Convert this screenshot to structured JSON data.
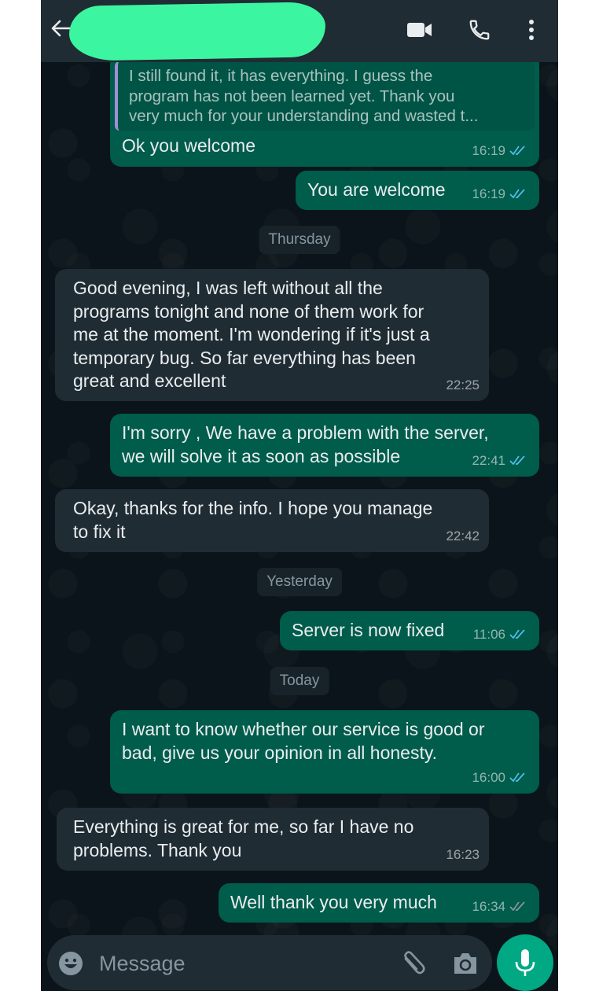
{
  "header": {
    "contact_name": "",
    "contact_name_redacted": true,
    "icons": [
      "back-arrow-icon",
      "video-call-icon",
      "voice-call-icon",
      "more-options-icon"
    ]
  },
  "colors": {
    "header_bg": "#202c33",
    "chat_bg": "#0b141a",
    "outgoing_bubble": "#005c4b",
    "incoming_bubble": "#202c33",
    "accent": "#00a884",
    "read_ticks": "#53bdeb",
    "redaction": "#3cf5a0"
  },
  "messages": [
    {
      "direction": "out",
      "quoted": "I still found it, it has everything. I guess the\nprogram has not been learned yet. Thank you\nvery much for your understanding and wasted t...",
      "text": "Ok you welcome",
      "time": "16:19",
      "status": "read"
    },
    {
      "direction": "out",
      "text": "You are welcome",
      "time": "16:19",
      "status": "read"
    },
    {
      "type": "date",
      "label": "Thursday"
    },
    {
      "direction": "in",
      "text": "Good evening, I was left without all the\nprograms tonight and none of them work for\nme at the moment. I'm wondering if it's just a\ntemporary bug. So far everything has been\ngreat and excellent",
      "time": "22:25"
    },
    {
      "direction": "out",
      "text": "I'm sorry , We have a problem with the server,\nwe will solve it as soon as possible",
      "time": "22:41",
      "status": "read"
    },
    {
      "direction": "in",
      "text": "Okay, thanks for the info. I hope you manage\nto fix it",
      "time": "22:42"
    },
    {
      "type": "date",
      "label": "Yesterday"
    },
    {
      "direction": "out",
      "text": "Server is now fixed",
      "time": "11:06",
      "status": "read"
    },
    {
      "type": "date",
      "label": "Today"
    },
    {
      "direction": "out",
      "text": "I want to know whether our service is good or\nbad, give us your opinion in all honesty.",
      "time": "16:00",
      "status": "read"
    },
    {
      "direction": "in",
      "text": "Everything is great for me, so far I have no\nproblems. Thank you",
      "time": "16:23"
    },
    {
      "direction": "out",
      "text": "Well thank you very much",
      "time": "16:34",
      "status": "read"
    }
  ],
  "composer": {
    "placeholder": "Message",
    "value": ""
  }
}
